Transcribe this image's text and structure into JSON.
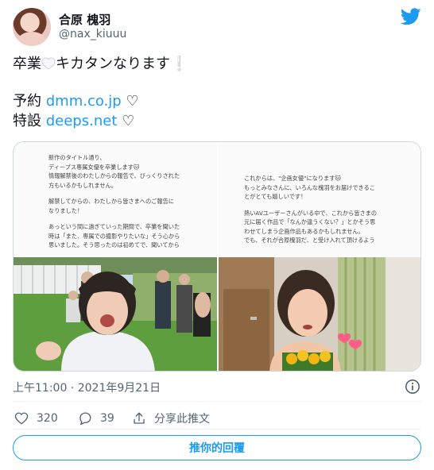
{
  "author": {
    "name": "合原 槐羽",
    "handle": "@nax_kiuuu"
  },
  "tweet": {
    "line1_before": "卒業",
    "line1_after": "キカタンなります",
    "line1_end": "❕",
    "line2_prefix": "予約 ",
    "line2_link": "dmm.co.jp",
    "line2_suffix": " ♡",
    "line3_prefix": "特設 ",
    "line3_link": "deeps.net",
    "line3_suffix": " ♡"
  },
  "media": {
    "left_note": [
      "新作のタイトル通り、\nディープス専属女優を卒業します🐱\n情報解禁後のわたしからの報告で、びっくりされた\n方もいるかもしれません。",
      "解禁してからの、わたしから皆さまへのご報告に\nなりました！",
      "あっという間に過ぎていった期間で、卒業を聞いた\n時は「また、専属での撮影やりたいな」そう心から\n思いました。そう思ったのは初めてで、聞いてから"
    ],
    "right_note": [
      "これからは、\"企画女優\"になります🐱\nもっとみなさんに、いろんな槐羽をお届けできるこ\nとがとても嬉しいです！",
      "熱いAVユーザーさんがいる中で、これから皆さまの\n元に届く作品で「なんか違うくない？」とかそう思\nわせてしまう企画作品もあるかもしれません。\nでも、それが合原槐羽だ、と受け入れて頂けるよう"
    ]
  },
  "meta": {
    "time": "上午11:00",
    "separator": " · ",
    "date": "2021年9月21日"
  },
  "actions": {
    "likes": "320",
    "replies": "39",
    "share_label": "分享此推文"
  },
  "reply_button": "推你的回覆",
  "colors": {
    "accent": "#1d9bf0",
    "text": "#0f1419",
    "muted": "#536471"
  },
  "icons": [
    "twitter-bird-icon",
    "white-heart-icon",
    "info-icon",
    "heart-icon",
    "reply-icon",
    "share-icon"
  ]
}
